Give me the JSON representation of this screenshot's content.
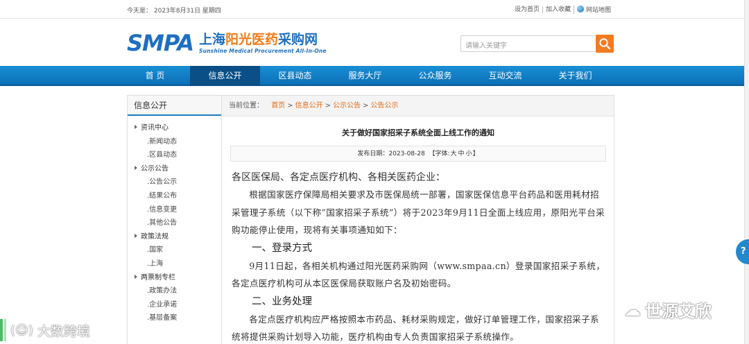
{
  "topbar": {
    "date": "今天是：  2023年8月31日 星期四",
    "set_home": "设为首页",
    "favorite": "加入收藏",
    "sitemap": "网站地图"
  },
  "logo": {
    "mark": "SMPA",
    "cn_part1": "上海",
    "cn_part2": "阳光医药",
    "cn_part3": "采购网",
    "en": "Sunshine Medical Procurement All-In-One"
  },
  "search": {
    "placeholder": "请输入关键字"
  },
  "nav": {
    "items": [
      "首 页",
      "信息公开",
      "区县动态",
      "服务大厅",
      "公众服务",
      "互动交流",
      "关于我们"
    ],
    "active_index": 1
  },
  "sidebar": {
    "title": "信息公开",
    "items": [
      {
        "label": "资讯中心",
        "type": "cat"
      },
      {
        "label": ".新闻动态",
        "type": "sub"
      },
      {
        "label": ".区县动态",
        "type": "sub"
      },
      {
        "label": "公示公告",
        "type": "cat"
      },
      {
        "label": ".公告公示",
        "type": "sub"
      },
      {
        "label": ".结果公布",
        "type": "sub"
      },
      {
        "label": ".信息变更",
        "type": "sub"
      },
      {
        "label": ".其他公告",
        "type": "sub"
      },
      {
        "label": "政策法规",
        "type": "cat"
      },
      {
        "label": ".国家",
        "type": "sub"
      },
      {
        "label": ".上海",
        "type": "sub"
      },
      {
        "label": "两票制专栏",
        "type": "cat"
      },
      {
        "label": ".政策办法",
        "type": "sub"
      },
      {
        "label": ".企业承诺",
        "type": "sub"
      },
      {
        "label": ".基层备案",
        "type": "sub"
      }
    ]
  },
  "breadcrumb": {
    "prefix": "当前位置：",
    "items": [
      "首页",
      "信息公开",
      "公示公告",
      "公告公示"
    ]
  },
  "article": {
    "title": "关于做好国家招采子系统全面上线工作的通知",
    "publish_label": "发布日期：",
    "publish_date": "2023-08-28",
    "font_label": "【字体:",
    "font_large": "大",
    "font_medium": "中",
    "font_small": "小",
    "font_end": "】",
    "greeting": "各区医保局、各定点医疗机构、各相关医药企业：",
    "para1": "根据国家医疗保障局相关要求及市医保局统一部署，国家医保信息平台药品和医用耗材招采管理子系统（以下称“国家招采子系统”）将于2023年9月11日全面上线应用，原阳光平台采购功能停止使用，现将有关事项通知如下：",
    "h1": "一、登录方式",
    "para2": "9月11日起，各相关机构通过阳光医药采购网（www.smpaa.cn）登录国家招采子系统，各定点医疗机构可从本区医保局获取账户名及初始密码。",
    "h2": "二、业务处理",
    "para3": "各定点医疗机构应严格按照本市药品、耗材采购规定，做好订单管理工作，国家招采子系统将提供采购计划导入功能，医疗机构由专人负责国家招采子系统操作。"
  },
  "watermarks": {
    "left": "大数跨境",
    "right": "世源艾欣"
  }
}
